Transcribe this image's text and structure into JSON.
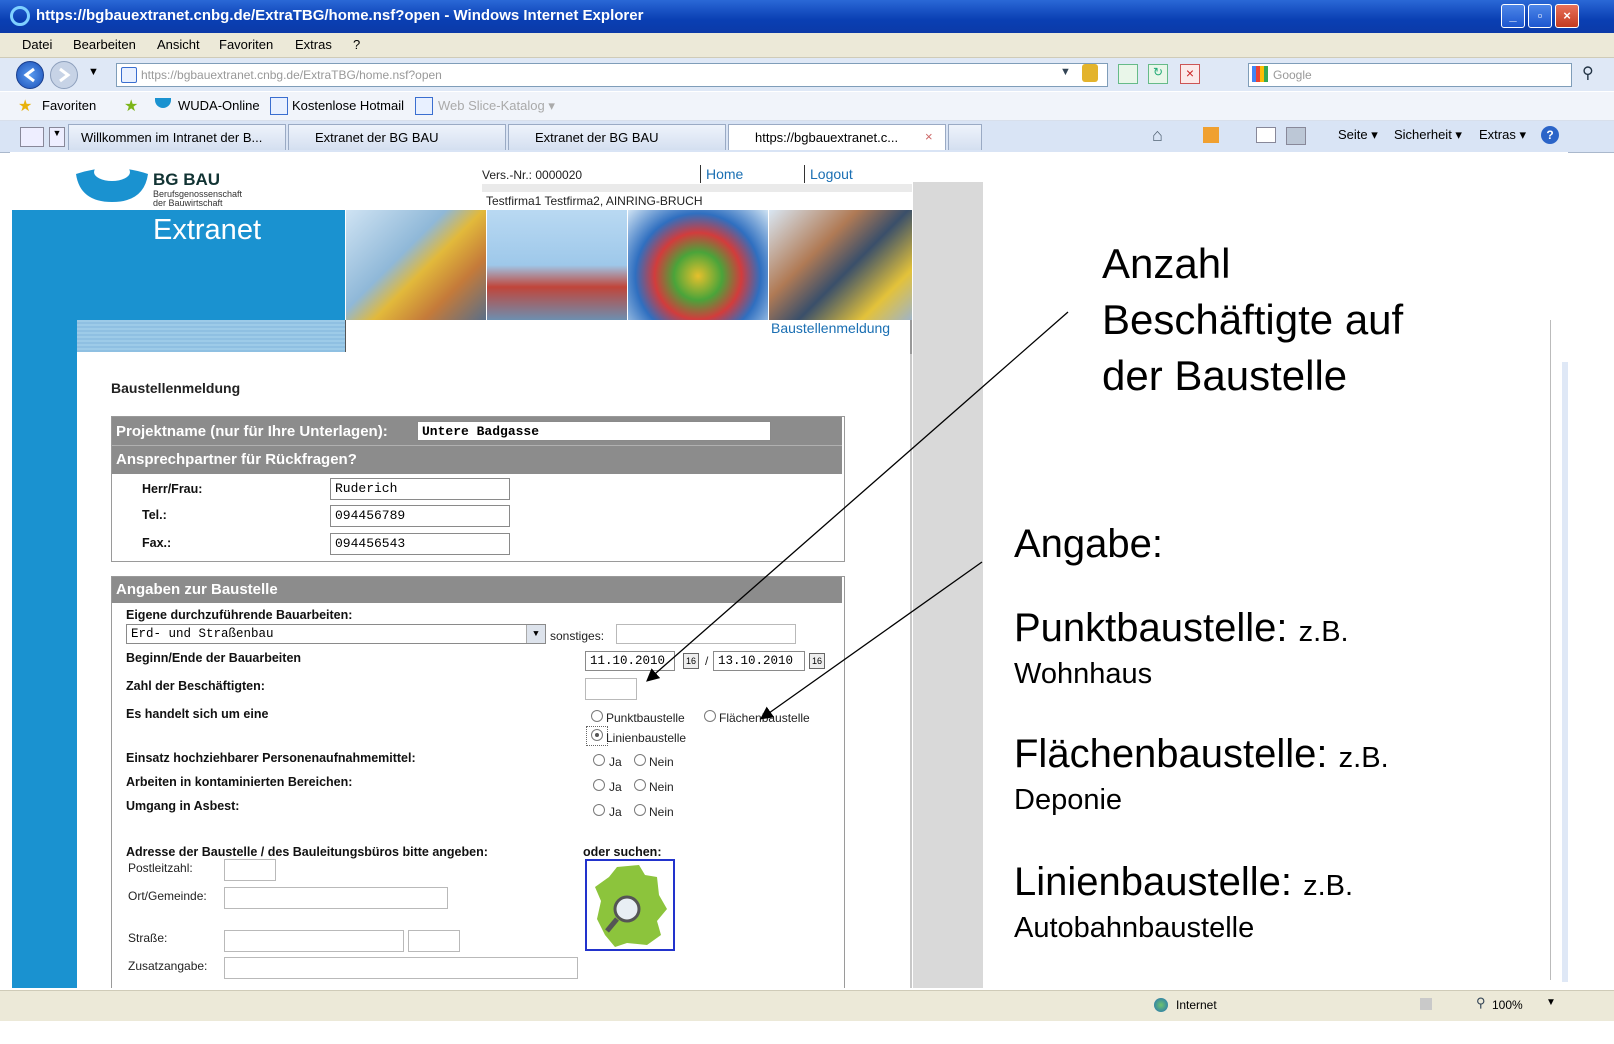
{
  "window": {
    "title": "https://bgbauextranet.cnbg.de/ExtraTBG/home.nsf?open - Windows Internet Explorer",
    "min": "_",
    "max": "▫",
    "close": "×"
  },
  "menu": [
    "Datei",
    "Bearbeiten",
    "Ansicht",
    "Favoriten",
    "Extras",
    "?"
  ],
  "address": {
    "url": "https://bgbauextranet.cnbg.de/ExtraTBG/home.nsf?open",
    "search_placeholder": "Google"
  },
  "favorites_bar": {
    "favorites_label": "Favoriten",
    "links": [
      "WUDA-Online",
      "Kostenlose Hotmail",
      "Web Slice-Katalog ▾"
    ]
  },
  "tabs": [
    "Willkommen im Intranet der B...",
    "Extranet der BG BAU",
    "Extranet der BG BAU",
    "https://bgbauextranet.c..."
  ],
  "command_bar": [
    "Seite ▾",
    "Sicherheit ▾",
    "Extras ▾"
  ],
  "site": {
    "logo_name": "BG BAU",
    "logo_sub1": "Berufsgenossenschaft",
    "logo_sub2": "der Bauwirtschaft",
    "extranet": "Extranet",
    "vers_nr": "Vers.-Nr.: 0000020",
    "home_link": "Home",
    "logout_link": "Logout",
    "company": "Testfirma1 Testfirma2, AINRING-BRUCH",
    "section_link": "Baustellenmeldung",
    "heading": "Baustellenmeldung"
  },
  "form": {
    "projektname_label": "Projektname (nur für Ihre Unterlagen):",
    "projektname_value": "Untere Badgasse",
    "ansprechpartner_label": "Ansprechpartner für Rückfragen?",
    "herr_frau_label": "Herr/Frau:",
    "herr_frau_value": "Ruderich",
    "tel_label": "Tel.:",
    "tel_value": "094456789",
    "fax_label": "Fax.:",
    "fax_value": "094456543",
    "angaben_label": "Angaben zur Baustelle",
    "bauarbeiten_label": "Eigene durchzuführende Bauarbeiten:",
    "bauarbeiten_value": "Erd- und Straßenbau",
    "sonstiges_label": "sonstiges:",
    "beginn_label": "Beginn/Ende der Bauarbeiten",
    "beginn_value": "11.10.2010",
    "ende_value": "13.10.2010",
    "date_sep": "/",
    "cal_icon": "16",
    "zahl_label": "Zahl der Beschäftigten:",
    "es_handelt_label": "Es handelt sich um eine",
    "punkt_label": "Punktbaustelle",
    "flaechen_label": "Flächenbaustelle",
    "linien_label": "Linienbaustelle",
    "einsatz_label": "Einsatz hochziehbarer Personenaufnahmemittel:",
    "kontaminiert_label": "Arbeiten in kontaminierten Bereichen:",
    "asbest_label": "Umgang in Asbest:",
    "ja_label": "Ja",
    "nein_label": "Nein",
    "adresse_label": "Adresse der Baustelle / des Bauleitungsbüros bitte angeben:",
    "oder_suchen_label": "oder suchen:",
    "plz_label": "Postleitzahl:",
    "ort_label": "Ort/Gemeinde:",
    "strasse_label": "Straße:",
    "zusatz_label": "Zusatzangabe:"
  },
  "annotations": {
    "anzahl_1": "Anzahl",
    "anzahl_2": "Beschäftigte auf",
    "anzahl_3": "der Baustelle",
    "angabe": "Angabe:",
    "punkt_big": "Punktbaustelle:",
    "punkt_small": "z.B.",
    "punkt_example": "Wohnhaus",
    "flaechen_big": "Flächenbaustelle:",
    "flaechen_small": "z.B.",
    "flaechen_example": "Deponie",
    "linien_big": "Linienbaustelle:",
    "linien_small": "z.B.",
    "linien_example": "Autobahnbaustelle"
  },
  "status": {
    "zone": "Internet",
    "zoom": "100%"
  },
  "colors": {
    "brand_blue": "#1a92d0",
    "form_header_gray": "#8c8c8c",
    "ie_title_blue": "#0a3fb3"
  }
}
